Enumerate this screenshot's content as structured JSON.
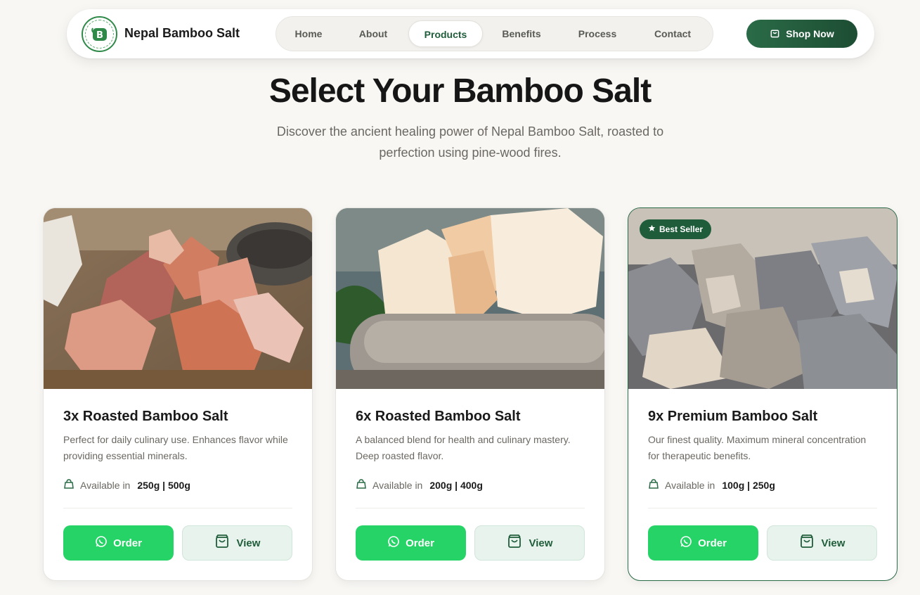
{
  "nav": {
    "brand": "Nepal Bamboo Salt",
    "links": [
      "Home",
      "About",
      "Products",
      "Benefits",
      "Process",
      "Contact"
    ],
    "active": "Products",
    "cta": "Shop Now"
  },
  "hero": {
    "title": "Select Your Bamboo Salt",
    "subtitle": "Discover the ancient healing power of Nepal Bamboo Salt, roasted to perfection using pine-wood fires."
  },
  "products": [
    {
      "title": "3x Roasted Bamboo Salt",
      "description": "Perfect for daily culinary use. Enhances flavor while providing essential minerals.",
      "available_label": "Available in",
      "sizes": "250g | 500g",
      "order_label": "Order",
      "view_label": "View",
      "badge": ""
    },
    {
      "title": "6x Roasted Bamboo Salt",
      "description": "A balanced blend for health and culinary mastery. Deep roasted flavor.",
      "available_label": "Available in",
      "sizes": "200g | 400g",
      "order_label": "Order",
      "view_label": "View",
      "badge": ""
    },
    {
      "title": "9x Premium Bamboo Salt",
      "description": "Our finest quality. Maximum mineral concentration for therapeutic benefits.",
      "available_label": "Available in",
      "sizes": "100g | 250g",
      "order_label": "Order",
      "view_label": "View",
      "badge": "Best Seller"
    }
  ],
  "colors": {
    "brand_green": "#1f5d3a",
    "whatsapp_green": "#25d366",
    "view_bg": "#e9f3ee",
    "background": "#f8f7f4"
  },
  "icons": [
    "logo-emblem",
    "shopping-bag-icon",
    "whatsapp-icon",
    "star-icon",
    "weight-icon"
  ]
}
